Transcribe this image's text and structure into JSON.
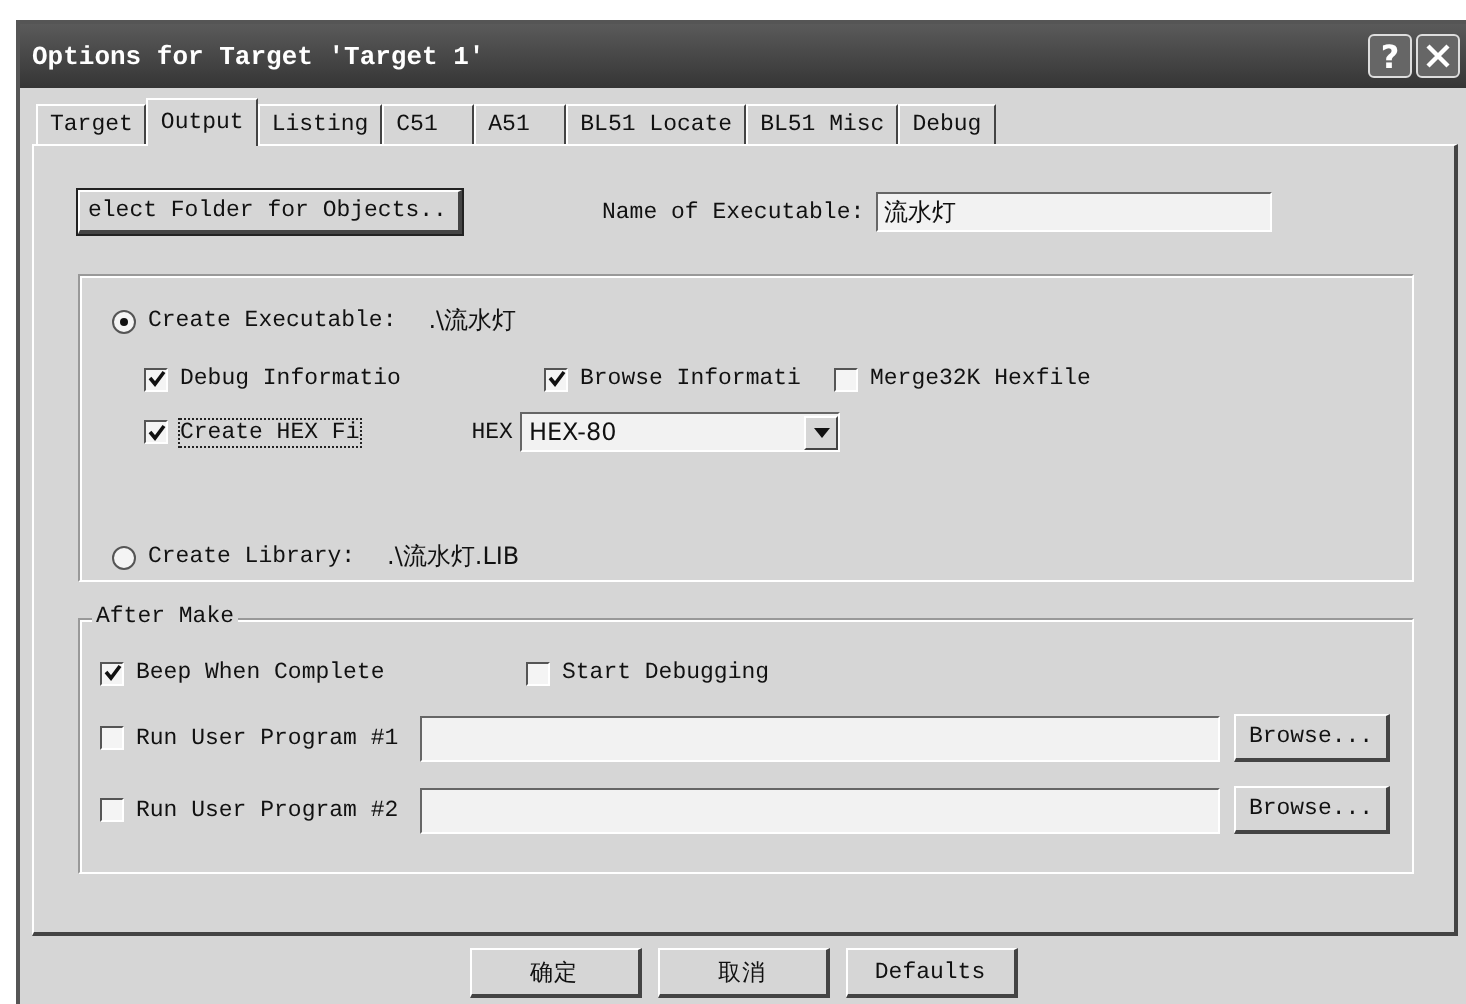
{
  "window": {
    "title": "Options for Target 'Target 1'",
    "help_button": "?"
  },
  "tabs": [
    {
      "label": "Target",
      "selected": false
    },
    {
      "label": "Output",
      "selected": true
    },
    {
      "label": "Listing",
      "selected": false
    },
    {
      "label": "C51",
      "selected": false
    },
    {
      "label": "A51",
      "selected": false
    },
    {
      "label": "BL51 Locate",
      "selected": false
    },
    {
      "label": "BL51 Misc",
      "selected": false
    },
    {
      "label": "Debug",
      "selected": false
    }
  ],
  "select_folder_button": "elect Folder for Objects..",
  "name_of_executable": {
    "label": "Name of Executable:",
    "value": "流水灯"
  },
  "create_executable": {
    "label": "Create Executable:",
    "path": ".\\流水灯",
    "selected": true
  },
  "debug_information": {
    "label": "Debug Informatio",
    "checked": true
  },
  "browse_information": {
    "label": "Browse Informati",
    "checked": true
  },
  "merge32k_hexfile": {
    "label": "Merge32K Hexfile",
    "checked": false
  },
  "create_hex_file": {
    "label": "Create HEX Fi",
    "checked": true
  },
  "hex_format": {
    "label": "HEX",
    "value": "HEX-80"
  },
  "create_library": {
    "label": "Create Library:",
    "path": ".\\流水灯.LIB",
    "selected": false
  },
  "after_make": {
    "title": "After Make",
    "beep_when_complete": {
      "label": "Beep When Complete",
      "checked": true
    },
    "start_debugging": {
      "label": "Start Debugging",
      "checked": false
    },
    "run_user_programs": [
      {
        "label": "Run User Program #1",
        "checked": false,
        "browse": "Browse..."
      },
      {
        "label": "Run User Program #2",
        "checked": false,
        "browse": "Browse..."
      }
    ]
  },
  "buttons": [
    "确定",
    "取消",
    "Defaults"
  ]
}
